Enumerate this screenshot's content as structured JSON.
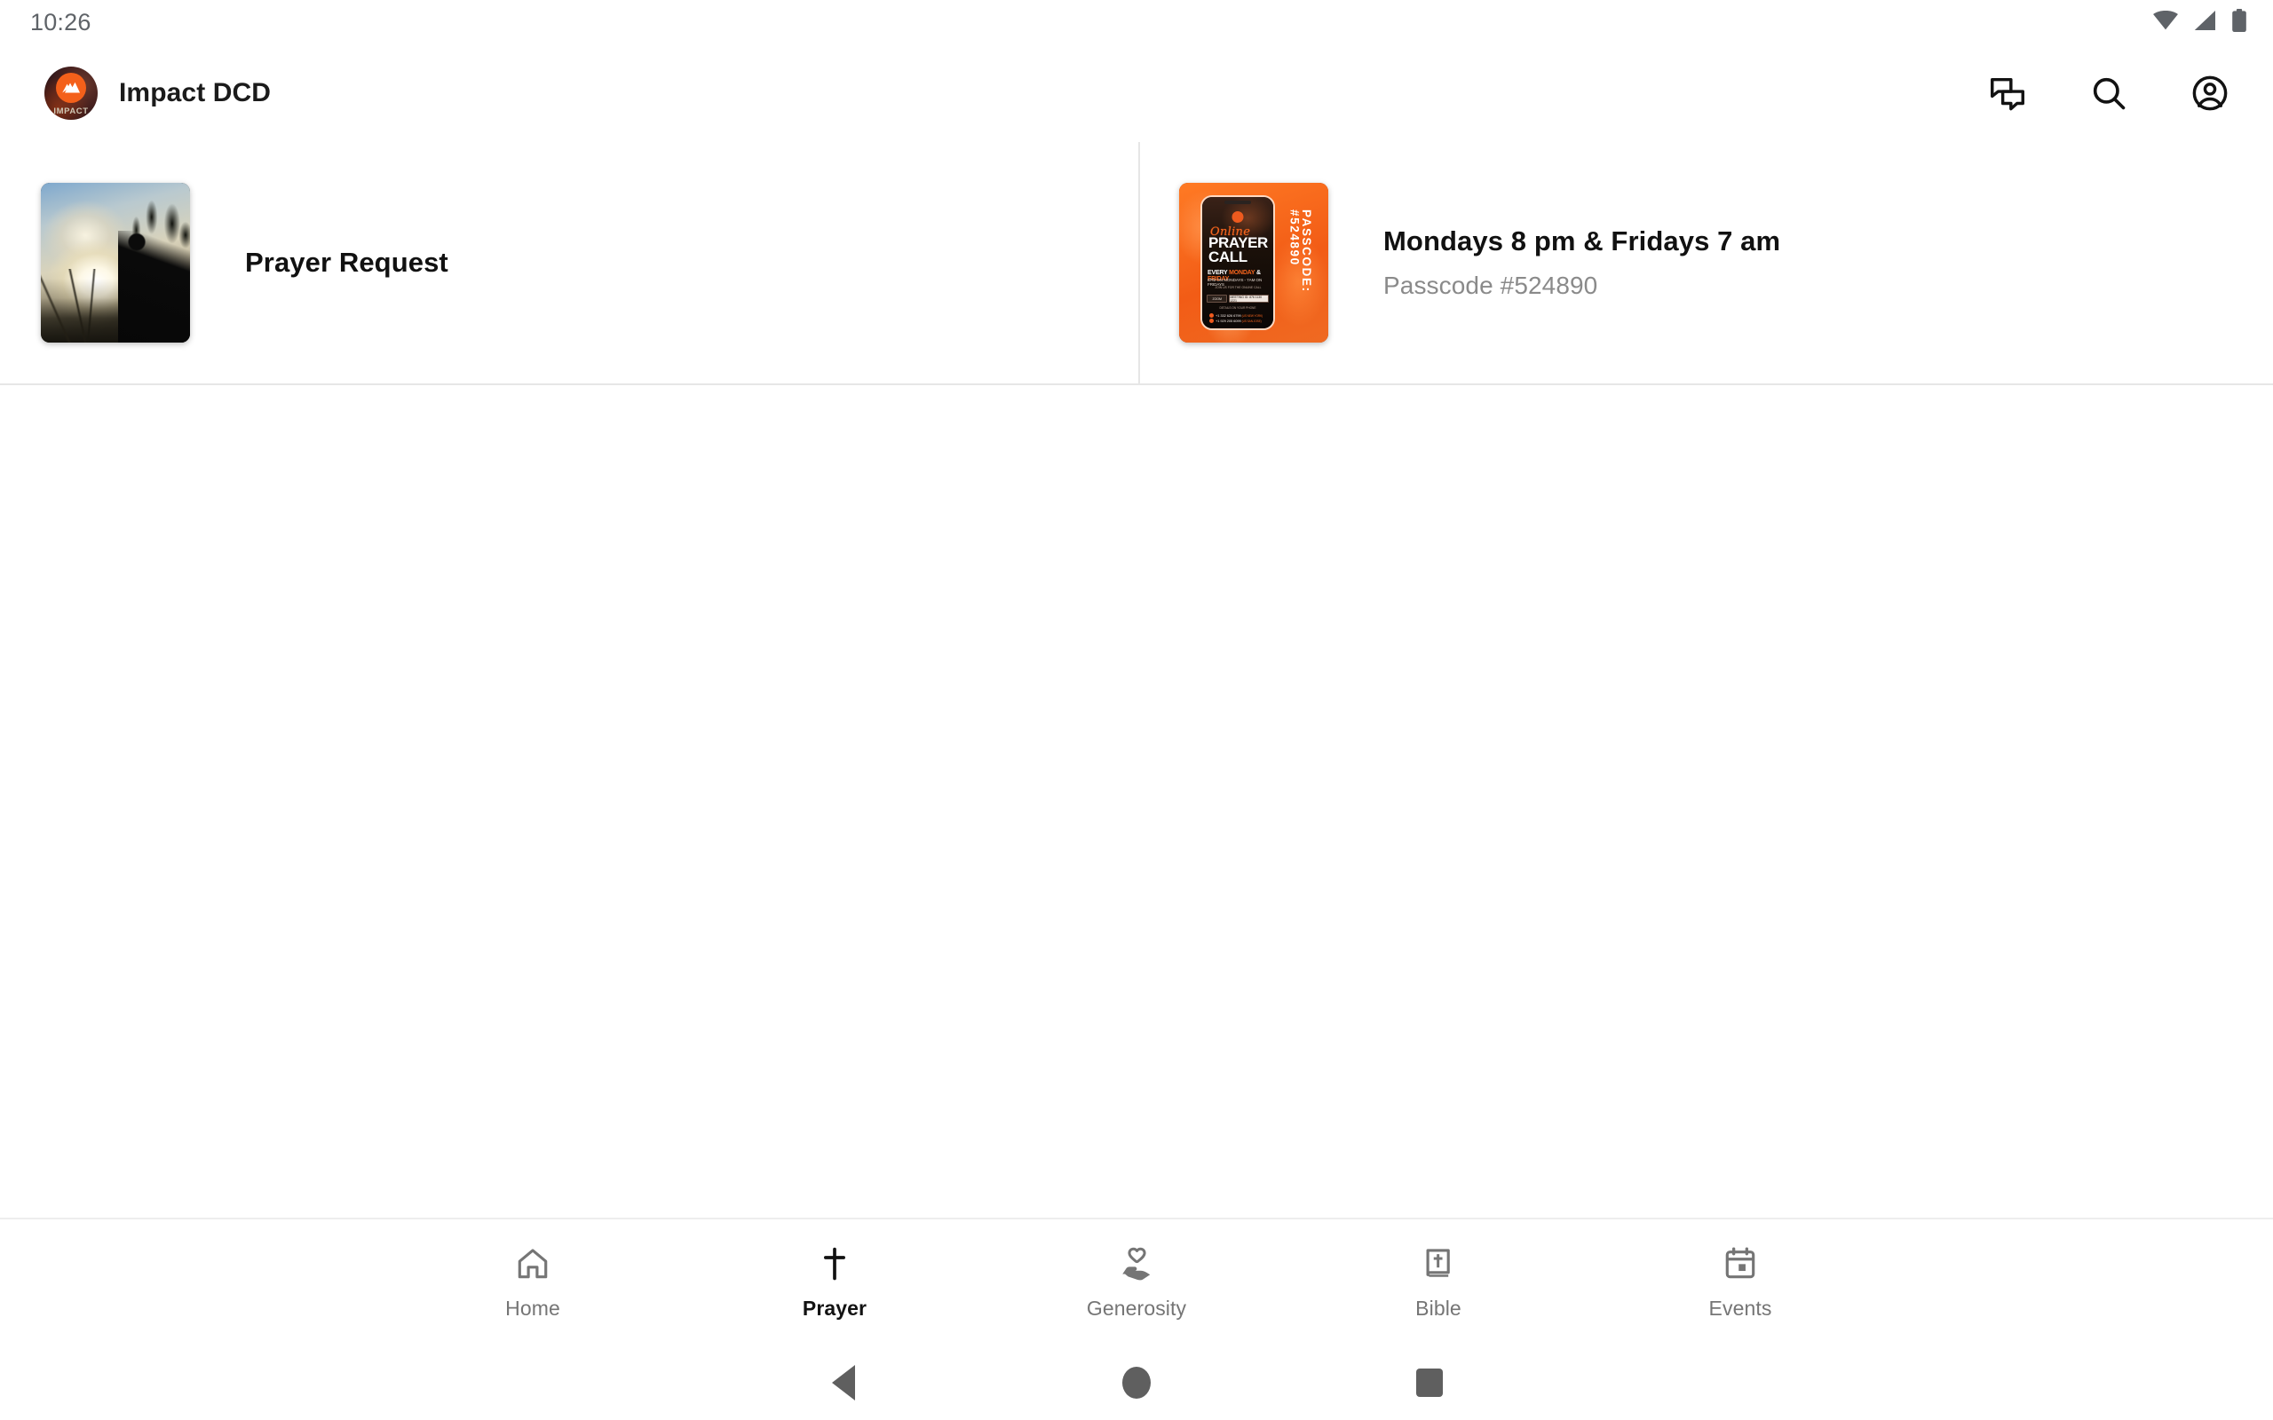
{
  "status_bar": {
    "time": "10:26",
    "icons": [
      "wifi-icon",
      "cellular-signal-icon",
      "battery-icon"
    ]
  },
  "app_bar": {
    "logo_word": "IMPACT",
    "title": "Impact DCD",
    "actions": [
      {
        "name": "messages-icon",
        "label": "Messages"
      },
      {
        "name": "search-icon",
        "label": "Search"
      },
      {
        "name": "account-icon",
        "label": "Account"
      }
    ]
  },
  "main": {
    "cards": [
      {
        "title": "Prayer Request",
        "subtitle": "",
        "image": "prayer-silhouette-photo"
      },
      {
        "title": "Mondays 8 pm & Fridays 7 am",
        "subtitle": "Passcode #524890",
        "image": "online-prayer-call-flyer"
      }
    ],
    "flyer": {
      "script": "Online",
      "headline_1": "PRAYER",
      "headline_2": "CALL",
      "days_prefix": "EVERY ",
      "days_hi_1": "MONDAY",
      "days_amp": " & ",
      "days_hi_2": "FRIDAY",
      "times": "8PM ON MONDAYS     -     7AM ON FRIDAYS",
      "sub": "JOIN US FOR THE ONLINE CALL",
      "chip_1": "ZOOM",
      "chip_2": "MEETING ID: 876 1130 1221",
      "divider": "DETAILS ON YOUR PHONE",
      "tel_1": "+1 332 626 6799",
      "tel_tag_1": "(US NEW YORK)",
      "tel_2": "+1 929 205 6099",
      "tel_tag_2": "(US SAN JOSE)",
      "passcode": "PASSCODE: #524890"
    }
  },
  "bottom_nav": {
    "items": [
      {
        "label": "Home",
        "icon": "home-icon",
        "active": false
      },
      {
        "label": "Prayer",
        "icon": "cross-icon",
        "active": true
      },
      {
        "label": "Generosity",
        "icon": "hand-heart-icon",
        "active": false
      },
      {
        "label": "Bible",
        "icon": "bible-book-icon",
        "active": false
      },
      {
        "label": "Events",
        "icon": "calendar-icon",
        "active": false
      }
    ]
  },
  "system_nav": {
    "back": "back-button",
    "home": "home-button",
    "recents": "recents-button"
  },
  "colors": {
    "accent_orange": "#f4631c",
    "text_primary": "#111111",
    "text_secondary": "#8a8a8a",
    "nav_inactive": "#757575",
    "divider": "#e6e6e6"
  }
}
